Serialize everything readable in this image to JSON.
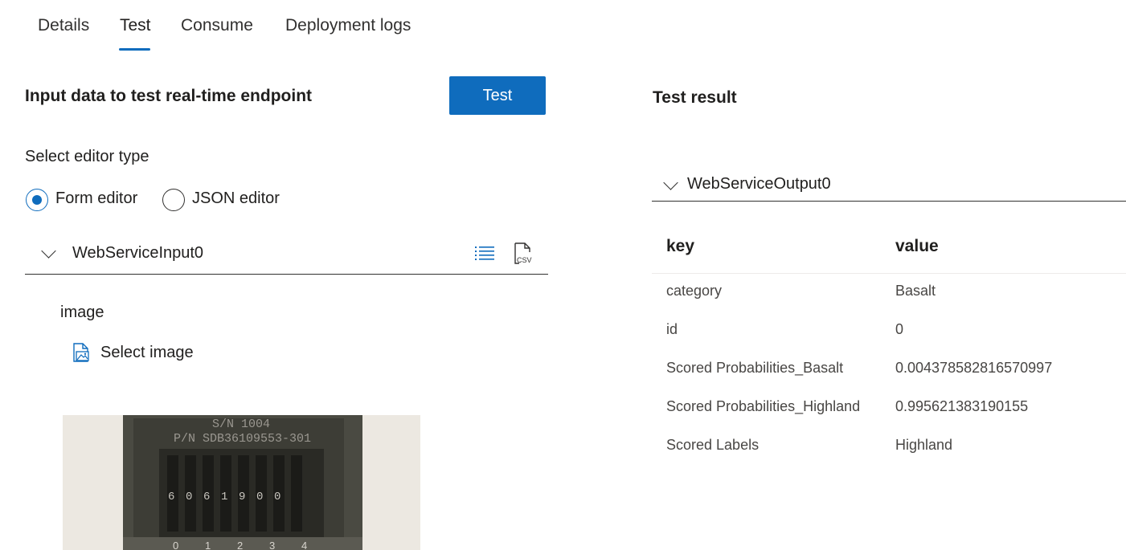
{
  "tabs": [
    {
      "label": "Details"
    },
    {
      "label": "Test"
    },
    {
      "label": "Consume"
    },
    {
      "label": "Deployment logs"
    }
  ],
  "active_tab": "Test",
  "input_panel": {
    "title": "Input data to test real-time endpoint",
    "test_button": "Test",
    "editor_type_label": "Select editor type",
    "editor_options": [
      {
        "label": "Form editor",
        "selected": true
      },
      {
        "label": "JSON editor",
        "selected": false
      }
    ],
    "web_service_input": {
      "name": "WebServiceInput0",
      "list_icon": "list-icon",
      "csv_icon": "csv-file-icon",
      "field_label": "image",
      "select_image_label": "Select image",
      "preview_text": {
        "serial": "S/N 1004",
        "part_number": "P/N SDB36109553-301",
        "counter_digits": [
          "6",
          "0",
          "6",
          "1",
          "9",
          "0",
          "0"
        ],
        "scale_digits": [
          "0",
          "1",
          "2",
          "3",
          "4"
        ]
      }
    }
  },
  "result_panel": {
    "title": "Test result",
    "output_name": "WebServiceOutput0",
    "columns": {
      "key": "key",
      "value": "value"
    },
    "rows": [
      {
        "key": "category",
        "value": "Basalt"
      },
      {
        "key": "id",
        "value": "0"
      },
      {
        "key": "Scored Probabilities_Basalt",
        "value": "0.004378582816570997"
      },
      {
        "key": "Scored Probabilities_Highland",
        "value": "0.995621383190155"
      },
      {
        "key": "Scored Labels",
        "value": "Highland"
      }
    ]
  },
  "colors": {
    "accent": "#0f6cbd",
    "text": "#201f1e",
    "muted_text": "#484644",
    "divider": "#323130"
  }
}
